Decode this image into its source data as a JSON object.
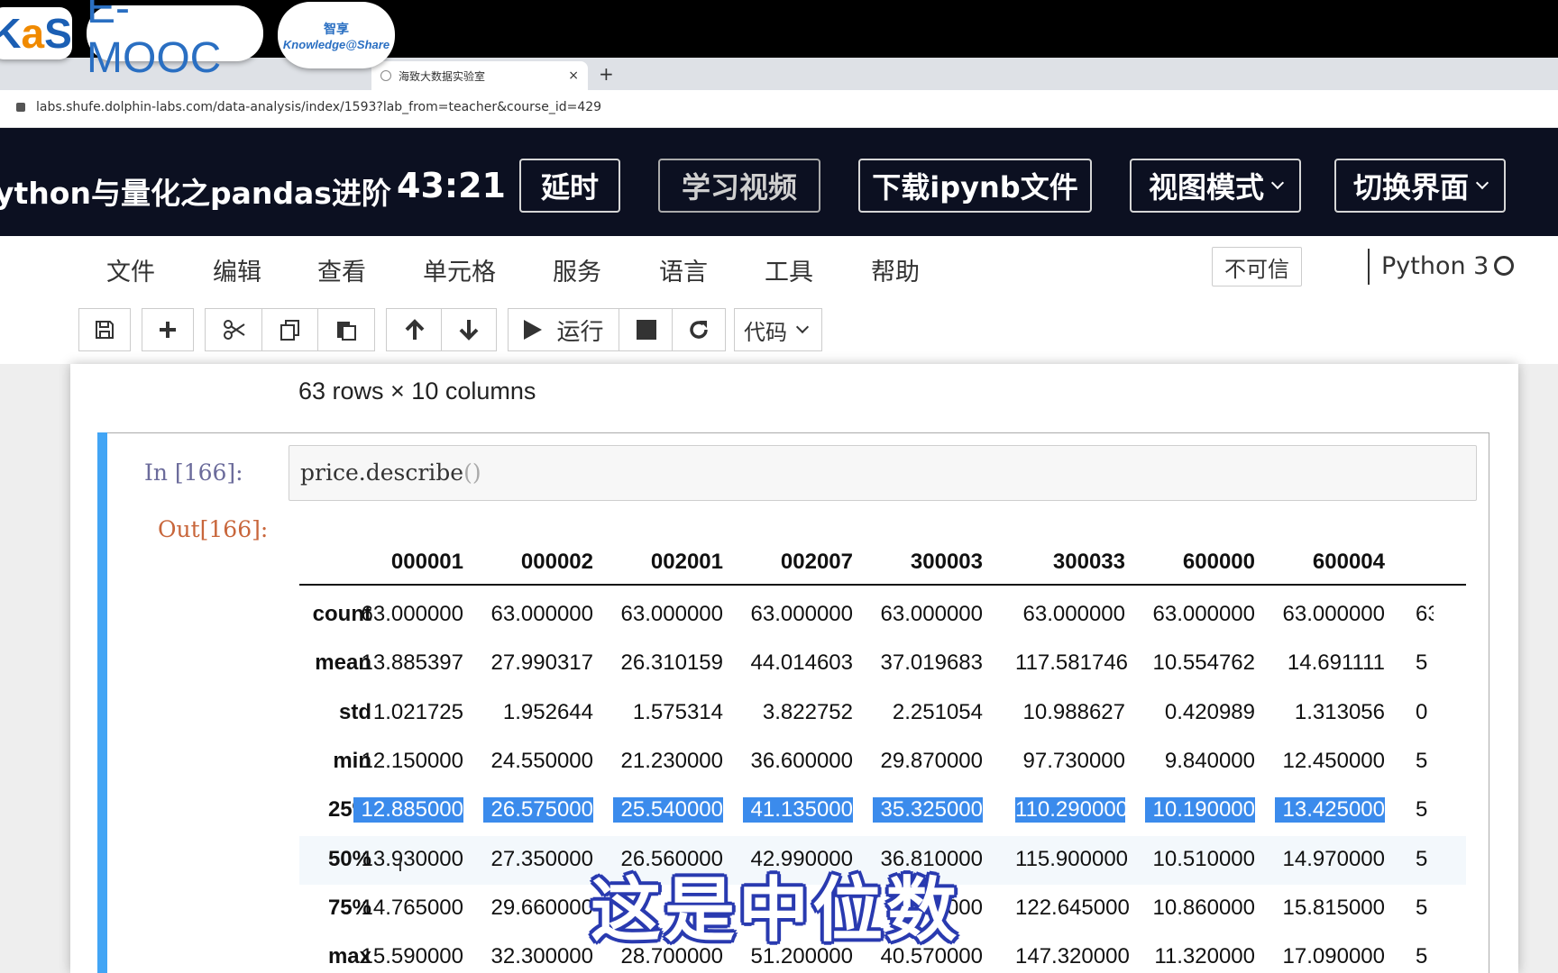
{
  "browser": {
    "logos": {
      "kas_left": "K",
      "kas_accent": "a",
      "kas_right": "S",
      "emooc": "E-MOOC",
      "ks_zh": "智享",
      "ks_en": "Knowledge@Share"
    },
    "tab_title": "海致大数据实验室",
    "tab_close": "×",
    "new_tab": "+",
    "url": "labs.shufe.dolphin-labs.com/data-analysis/index/1593?lab_from=teacher&course_id=429"
  },
  "course": {
    "title": "ython与量化之pandas进阶",
    "timer": "43:21",
    "buttons": {
      "delay": "延时",
      "video": "学习视频",
      "download": "下载ipynb文件",
      "view_mode": "视图模式",
      "switch_ui": "切换界面"
    }
  },
  "menu": {
    "items": [
      "文件",
      "编辑",
      "查看",
      "单元格",
      "服务",
      "语言",
      "工具",
      "帮助"
    ],
    "trust": "不可信",
    "kernel_name": "Python 3"
  },
  "toolbar": {
    "icons": [
      "save-icon",
      "plus-icon",
      "scissors-icon",
      "copy-icon",
      "paste-icon",
      "arrow-up-icon",
      "arrow-down-icon",
      "play-icon",
      "stop-icon",
      "restart-icon"
    ],
    "run_label": "运行",
    "cell_type": "代码"
  },
  "notebook": {
    "prev_output": "63 rows × 10 columns",
    "in_prompt": "In  [166]:",
    "code": "price.describe",
    "code_parens": "()",
    "out_prompt": "Out[166]:"
  },
  "dataframe": {
    "columns": [
      "000001",
      "000002",
      "002001",
      "002007",
      "300003",
      "300033",
      "600000",
      "600004"
    ],
    "rows": [
      {
        "label": "count",
        "values": [
          "63.000000",
          "63.000000",
          "63.000000",
          "63.000000",
          "63.000000",
          "63.000000",
          "63.000000",
          "63.000000"
        ],
        "trunc": "63"
      },
      {
        "label": "mean",
        "values": [
          "13.885397",
          "27.990317",
          "26.310159",
          "44.014603",
          "37.019683",
          "117.581746",
          "10.554762",
          "14.691111"
        ],
        "trunc": "5"
      },
      {
        "label": "std",
        "values": [
          "1.021725",
          "1.952644",
          "1.575314",
          "3.822752",
          "2.251054",
          "10.988627",
          "0.420989",
          "1.313056"
        ],
        "trunc": "0"
      },
      {
        "label": "min",
        "values": [
          "12.150000",
          "24.550000",
          "21.230000",
          "36.600000",
          "29.870000",
          "97.730000",
          "9.840000",
          "12.450000"
        ],
        "trunc": "5"
      },
      {
        "label": "25%",
        "values": [
          "12.885000",
          "26.575000",
          "25.540000",
          "41.135000",
          "35.325000",
          "110.290000",
          "10.190000",
          "13.425000"
        ],
        "trunc": "5"
      },
      {
        "label": "50%",
        "values": [
          "13.930000",
          "27.350000",
          "26.560000",
          "42.990000",
          "36.810000",
          "115.900000",
          "10.510000",
          "14.970000"
        ],
        "trunc": "5"
      },
      {
        "label": "75%",
        "values": [
          "14.765000",
          "29.660000",
          "",
          "",
          "40000",
          "122.645000",
          "10.860000",
          "15.815000"
        ],
        "trunc": "5"
      },
      {
        "label": "max",
        "values": [
          "15.590000",
          "32.300000",
          "28.700000",
          "51.200000",
          "40.570000",
          "147.320000",
          "11.320000",
          "17.090000"
        ],
        "trunc": "5"
      }
    ],
    "selected_row": "25%",
    "hover_row": "50%"
  },
  "subtitle": "这是中位数",
  "colors": {
    "course_header_bg": "#0c1021",
    "cell_selected_bar": "#42a5f5",
    "text_selection": "#3b8bec",
    "out_prompt": "#c8663b",
    "subtitle_outline": "#2a3bb0"
  }
}
